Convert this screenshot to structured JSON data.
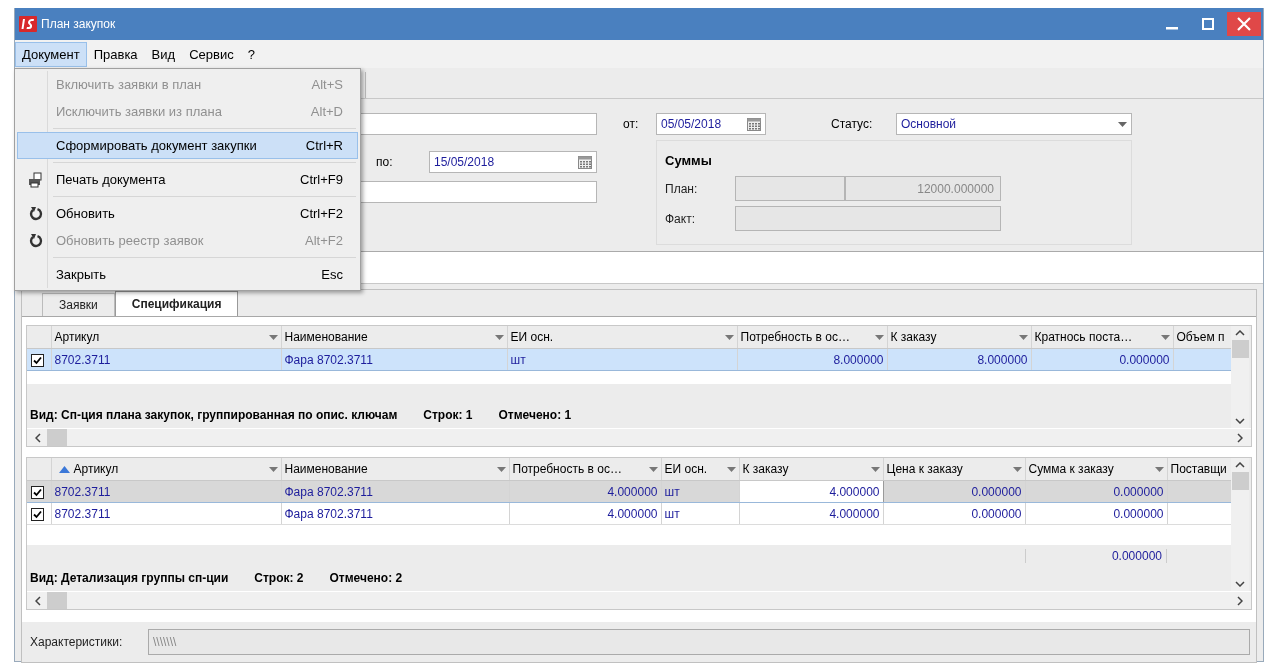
{
  "window": {
    "title": "План закупок"
  },
  "menu_bar": [
    {
      "label": "Документ",
      "selected": true
    },
    {
      "label": "Правка",
      "selected": false
    },
    {
      "label": "Вид",
      "selected": false
    },
    {
      "label": "Сервис",
      "selected": false
    },
    {
      "label": "?",
      "selected": false
    }
  ],
  "menu": [
    {
      "kind": "plain",
      "label": "Включить заявки в план",
      "shortcut": "Alt+S",
      "disabled": true,
      "selected": false,
      "separator_before": false
    },
    {
      "kind": "plain",
      "label": "Исключить заявки из плана",
      "shortcut": "Alt+D",
      "disabled": true,
      "selected": false,
      "separator_before": false
    },
    {
      "kind": "plain",
      "label": "Сформировать документ закупки",
      "shortcut": "Ctrl+R",
      "disabled": false,
      "selected": true,
      "separator_before": true
    },
    {
      "kind": "print",
      "label": "Печать документа",
      "shortcut": "Ctrl+F9",
      "disabled": false,
      "selected": false,
      "separator_before": true
    },
    {
      "kind": "refresh",
      "label": "Обновить",
      "shortcut": "Ctrl+F2",
      "disabled": false,
      "selected": false,
      "separator_before": true
    },
    {
      "kind": "refresh",
      "label": "Обновить реестр заявок",
      "shortcut": "Alt+F2",
      "disabled": true,
      "selected": false,
      "separator_before": false
    },
    {
      "kind": "plain",
      "label": "Закрыть",
      "shortcut": "Esc",
      "disabled": false,
      "selected": false,
      "separator_before": true
    }
  ],
  "form": {
    "date_to": {
      "label": "по:",
      "value": "15/05/2018"
    },
    "date_from": {
      "label": "от:",
      "value": "05/05/2018"
    },
    "status": {
      "label": "Статус:",
      "value": "Основной"
    },
    "sums": {
      "title": "Суммы",
      "plan": {
        "label": "План:",
        "value": "12000.000000"
      },
      "fact": {
        "label": "Факт:"
      }
    }
  },
  "tabs": [
    {
      "label": "Заявки",
      "selected": false
    },
    {
      "label": "Спецификация",
      "selected": true
    }
  ],
  "grid_1": {
    "columns": [
      {
        "label": "Артикул",
        "kind": "text",
        "sorted": false
      },
      {
        "label": "Наименование",
        "kind": "text",
        "sorted": false
      },
      {
        "label": "ЕИ осн.",
        "kind": "text",
        "sorted": false
      },
      {
        "label": "Потребность в ос…",
        "kind": "number",
        "sorted": false
      },
      {
        "label": "К заказу",
        "kind": "number",
        "sorted": false
      },
      {
        "label": "Кратнось поста…",
        "kind": "number",
        "sorted": false
      },
      {
        "label": "Объем п",
        "sorted": false
      }
    ],
    "rows": [
      {
        "checked": true,
        "selected": true,
        "cells": [
          {
            "text": "8702.3711",
            "editing": false
          },
          {
            "text": "Фара 8702.3711",
            "editing": false
          },
          {
            "text": "шт",
            "editing": false
          },
          {
            "text": "8.000000",
            "editing": false
          },
          {
            "text": "8.000000",
            "editing": false
          },
          {
            "text": "0.000000",
            "editing": false
          }
        ]
      }
    ],
    "view": "Вид: Сп-ция плана закупок, группированная по опис. ключам",
    "row_count": "Строк: 1",
    "marked": "Отмечено: 1"
  },
  "grid_2": {
    "columns": [
      {
        "label": "Артикул",
        "kind": "text",
        "sorted": true
      },
      {
        "label": "Наименование",
        "kind": "text",
        "sorted": false
      },
      {
        "label": "Потребность в ос…",
        "kind": "number",
        "sorted": false
      },
      {
        "label": "ЕИ осн.",
        "kind": "text",
        "sorted": false
      },
      {
        "label": "К заказу",
        "kind": "number",
        "sorted": false
      },
      {
        "label": "Цена к заказу",
        "kind": "number",
        "sorted": false
      },
      {
        "label": "Сумма к заказу",
        "kind": "number",
        "sorted": false
      },
      {
        "label": "Поставщи",
        "sorted": false
      }
    ],
    "rows": [
      {
        "checked": true,
        "selected": true,
        "cells": [
          {
            "text": "8702.3711",
            "editing": false
          },
          {
            "text": "Фара 8702.3711",
            "editing": false
          },
          {
            "text": "4.000000",
            "editing": false
          },
          {
            "text": "шт",
            "editing": false
          },
          {
            "text": "4.000000",
            "editing": true
          },
          {
            "text": "0.000000",
            "editing": false
          },
          {
            "text": "0.000000",
            "editing": false
          }
        ]
      },
      {
        "checked": true,
        "selected": false,
        "cells": [
          {
            "text": "8702.3711",
            "editing": false
          },
          {
            "text": "Фара 8702.3711",
            "editing": false
          },
          {
            "text": "4.000000",
            "editing": false
          },
          {
            "text": "шт",
            "editing": false
          },
          {
            "text": "4.000000",
            "editing": false
          },
          {
            "text": "0.000000",
            "editing": false
          },
          {
            "text": "0.000000",
            "editing": false
          }
        ]
      }
    ],
    "total_sum": "0.000000",
    "view": "Вид: Детализация группы сп-ции",
    "row_count": "Строк: 2",
    "marked": "Отмечено: 2"
  },
  "characteristics": {
    "label": "Характеристики:",
    "value": "\\\\\\\\\\\\\\"
  }
}
